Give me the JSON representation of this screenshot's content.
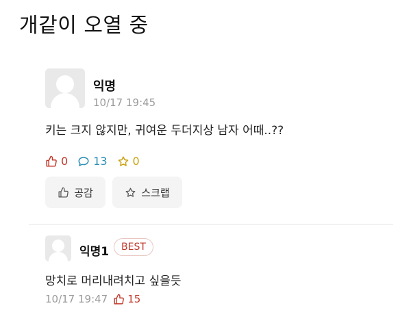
{
  "page": {
    "title": "개같이 오열 중"
  },
  "post": {
    "author": "익명",
    "time": "10/17 19:45",
    "content": "키는 크지 않지만, 귀여운 두더지상 남자 어때..??",
    "stats": {
      "likes": "0",
      "comments": "13",
      "scraps": "0"
    },
    "actions": {
      "like_label": "공감",
      "scrap_label": "스크랩"
    }
  },
  "comment": {
    "author": "익명1",
    "badge": "BEST",
    "content": "망치로 머리내려치고 싶을듯",
    "time": "10/17 19:47",
    "likes": "15"
  },
  "colors": {
    "like": "#c0392b",
    "comment": "#2a8fb5",
    "scrap": "#c9a212",
    "muted": "#9a9a9a"
  },
  "icons": {
    "like": "thumbs-up-icon",
    "comment": "speech-bubble-icon",
    "scrap": "star-icon"
  }
}
